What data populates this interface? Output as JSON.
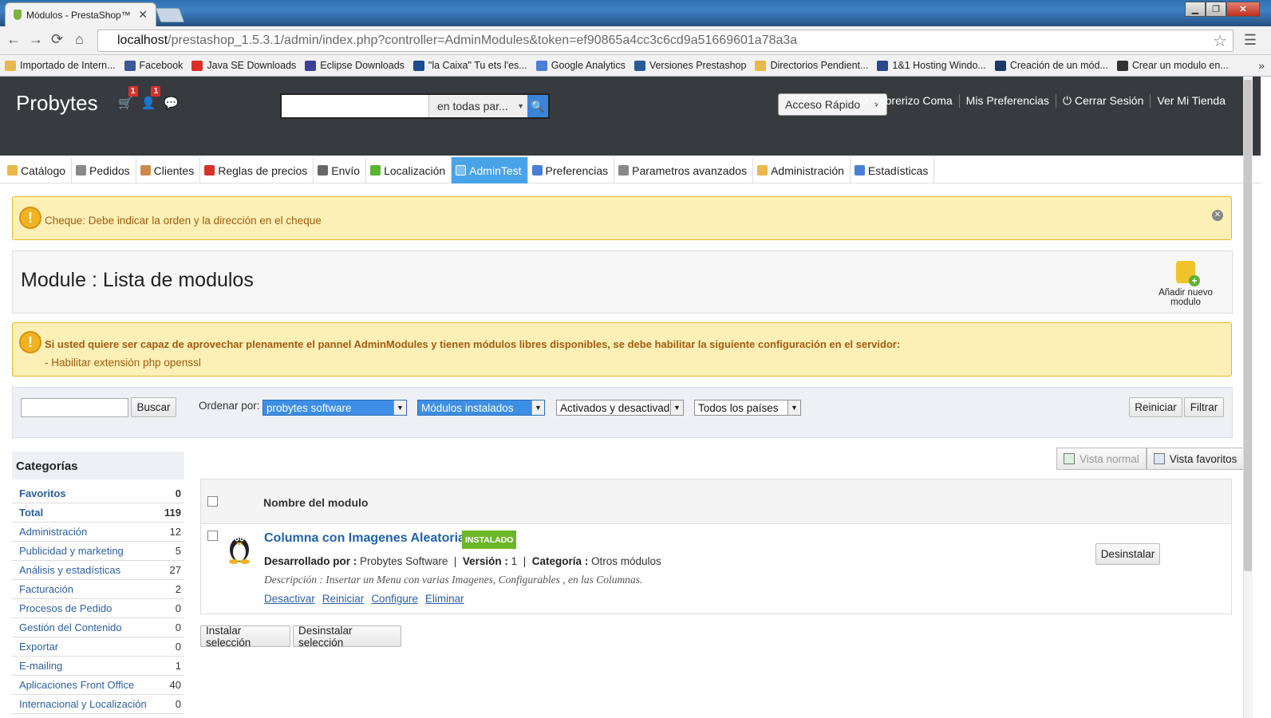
{
  "browser": {
    "tab_title": "Módulos - PrestaShop™",
    "url_host": "localhost",
    "url_rest": "/prestashop_1.5.3.1/admin/index.php?controller=AdminModules&token=ef90865a4cc3c6cd9a51669601a78a3a",
    "bookmarks": [
      {
        "label": "Importado de Intern...",
        "icon": "folder-icon",
        "color": "#e8b84a"
      },
      {
        "label": "Facebook",
        "icon": "facebook-icon",
        "color": "#3b5998"
      },
      {
        "label": "Java SE Downloads",
        "icon": "java-icon",
        "color": "#d9302a"
      },
      {
        "label": "Eclipse Downloads",
        "icon": "eclipse-icon",
        "color": "#3b3f9e"
      },
      {
        "label": "\"la Caixa\" Tu ets l'es...",
        "icon": "caixa-icon",
        "color": "#1a4f8f"
      },
      {
        "label": "Google Analytics",
        "icon": "google-icon",
        "color": "#4a7fd6"
      },
      {
        "label": "Versiones Prestashop",
        "icon": "prestashop-icon",
        "color": "#2a5a9a"
      },
      {
        "label": "Directorios Pendient...",
        "icon": "folder-icon",
        "color": "#e8b84a"
      },
      {
        "label": "1&1 Hosting Windo...",
        "icon": "hosting-icon",
        "color": "#2a4a8a"
      },
      {
        "label": "Creación de un mód...",
        "icon": "tool-icon",
        "color": "#1a3a6a"
      },
      {
        "label": "Crear un modulo en...",
        "icon": "page-icon",
        "color": "#333333"
      }
    ]
  },
  "header": {
    "shop_name": "Probytes",
    "cart_badge": "1",
    "customers_badge": "1",
    "search_scope": "en todas par...",
    "quick_access": "Acceso Rápido",
    "user": "O Cabrerizo Coma",
    "prefs": "Mis Preferencias",
    "logout": "Cerrar Sesión",
    "shop_link": "Ver Mi Tienda"
  },
  "tabs": [
    {
      "label": "Catálogo",
      "icon": "folder-icon",
      "color": "#e8b84a",
      "active": false
    },
    {
      "label": "Pedidos",
      "icon": "cart-icon",
      "color": "#888888",
      "active": false
    },
    {
      "label": "Clientes",
      "icon": "user-icon",
      "color": "#c98a4a",
      "active": false
    },
    {
      "label": "Reglas de precios",
      "icon": "price-icon",
      "color": "#d9302a",
      "active": false
    },
    {
      "label": "Envío",
      "icon": "truck-icon",
      "color": "#666666",
      "active": false
    },
    {
      "label": "Localización",
      "icon": "globe-icon",
      "color": "#5ab432",
      "active": false
    },
    {
      "label": "AdminTest",
      "icon": "blank-icon",
      "color": "#7fc0f0",
      "active": true
    },
    {
      "label": "Preferencias",
      "icon": "preferences-icon",
      "color": "#4a7fd6",
      "active": false
    },
    {
      "label": "Parametros avanzados",
      "icon": "wrench-icon",
      "color": "#888888",
      "active": false
    },
    {
      "label": "Administración",
      "icon": "key-icon",
      "color": "#e8b84a",
      "active": false
    },
    {
      "label": "Estadísticas",
      "icon": "stats-icon",
      "color": "#4a7fd6",
      "active": false
    }
  ],
  "alert1": "Cheque: Debe indicar la orden y la dirección en el cheque",
  "page_title": "Module : Lista de modulos",
  "add_module": "Añadir nuevo modulo",
  "alert2": {
    "main": "Si usted quiere ser capaz de aprovechar plenamente el pannel AdminModules y tienen módulos libres disponibles, se debe habilitar la siguiente configuración en el servidor:",
    "item": "- Habilitar extensión php openssl"
  },
  "filters": {
    "search_btn": "Buscar",
    "order_label": "Ordenar por:",
    "author": "probytes software",
    "installed": "Módulos instalados",
    "status": "Activados y desactivados",
    "country": "Todos los países",
    "reset": "Reiniciar",
    "filter": "Filtrar"
  },
  "categories": {
    "title": "Categorías",
    "items": [
      {
        "label": "Favoritos",
        "count": "0",
        "bold": true
      },
      {
        "label": "Total",
        "count": "119",
        "bold": true
      },
      {
        "label": "Administración",
        "count": "12"
      },
      {
        "label": "Publicidad y marketing",
        "count": "5"
      },
      {
        "label": "Análisis y estadísticas",
        "count": "27"
      },
      {
        "label": "Facturación",
        "count": "2"
      },
      {
        "label": "Procesos de Pedido",
        "count": "0"
      },
      {
        "label": "Gestión del Contenido",
        "count": "0"
      },
      {
        "label": "Exportar",
        "count": "0"
      },
      {
        "label": "E-mailing",
        "count": "1"
      },
      {
        "label": "Aplicaciones Front Office",
        "count": "40"
      },
      {
        "label": "Internacional y Localización",
        "count": "0"
      }
    ]
  },
  "views": {
    "normal": "Vista normal",
    "favorites": "Vista favoritos"
  },
  "table": {
    "header": "Nombre del modulo",
    "module": {
      "name": "Columna con Imagenes Aleatorias",
      "status": "INSTALADO",
      "dev_label": "Desarrollado por :",
      "dev": "Probytes Software",
      "ver_label": "Versión :",
      "version": "1",
      "cat_label": "Categoría :",
      "category": "Otros módulos",
      "desc_label": "Descripción :",
      "description": "Insertar un Menu con varias Imagenes, Configurables , en las Columnas.",
      "actions": [
        "Desactivar",
        "Reiniciar",
        "Configure",
        "Eliminar"
      ],
      "uninstall": "Desinstalar"
    }
  },
  "bulk": {
    "install": "Instalar selección",
    "uninstall": "Desinstalar selección"
  }
}
